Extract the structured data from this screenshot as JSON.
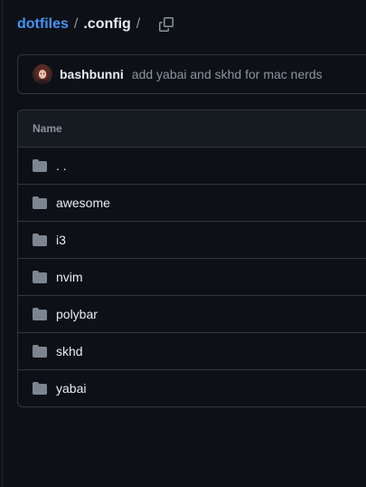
{
  "breadcrumb": {
    "repo": "dotfiles",
    "separator": "/",
    "current": ".config",
    "trailing": "/"
  },
  "commit": {
    "author": "bashbunni",
    "message": "add yabai and skhd for mac nerds"
  },
  "table": {
    "header": "Name",
    "rows": [
      {
        "name": ". ."
      },
      {
        "name": "awesome"
      },
      {
        "name": "i3"
      },
      {
        "name": "nvim"
      },
      {
        "name": "polybar"
      },
      {
        "name": "skhd"
      },
      {
        "name": "yabai"
      }
    ]
  },
  "colors": {
    "background": "#0d1117",
    "link": "#4493f8",
    "border": "#30363d",
    "muted": "#8b949e",
    "icon": "#7d8590"
  },
  "icons": {
    "copy": "copy-icon",
    "folder": "folder-icon"
  }
}
